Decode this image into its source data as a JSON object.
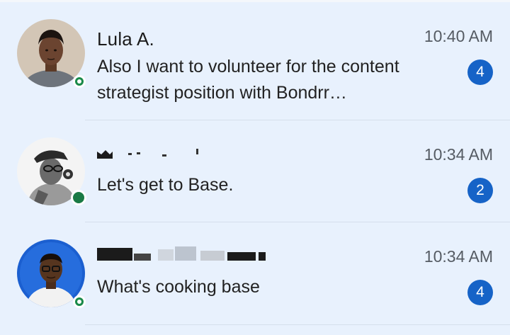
{
  "chats": [
    {
      "name": "Lula A.",
      "time": "10:40 AM",
      "preview": "Also I want to volunteer for the content strategist position with Bondrr…",
      "unread": "4"
    },
    {
      "name": "",
      "time": "10:34 AM",
      "preview": "Let's get to Base.",
      "unread": "2"
    },
    {
      "name": "",
      "time": "10:34 AM",
      "preview": "What's cooking base",
      "unread": "4"
    }
  ],
  "colors": {
    "background": "#e8f1fd",
    "badge": "#1663c7",
    "online": "#1a8a4a"
  }
}
